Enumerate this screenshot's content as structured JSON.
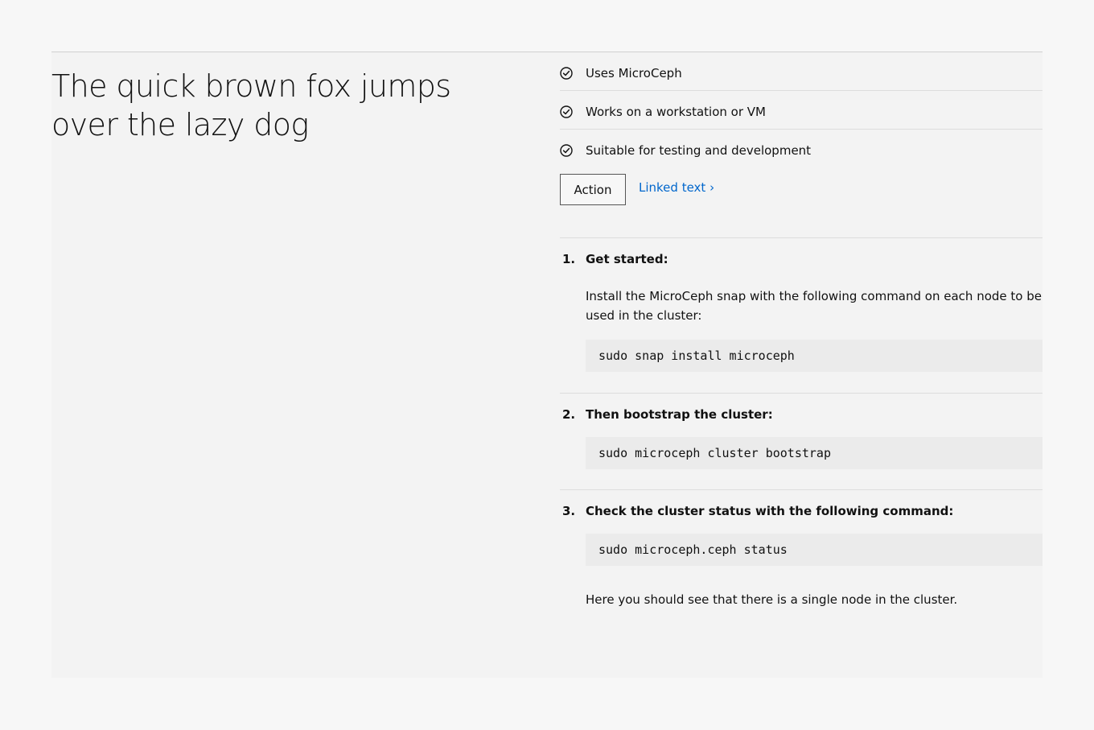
{
  "title": "The quick brown fox jumps over the lazy dog",
  "checks": [
    {
      "label": "Uses MicroCeph",
      "icon": "check-circle-icon"
    },
    {
      "label": "Works on a workstation or VM",
      "icon": "check-circle-icon"
    },
    {
      "label": "Suitable for testing and development",
      "icon": "check-circle-icon"
    }
  ],
  "actions": {
    "button_label": "Action",
    "link_text": "Linked text ›"
  },
  "steps": [
    {
      "number": "1.",
      "title": "Get started:",
      "text": "Install the MicroCeph snap with the following command on each node to be used in the cluster:",
      "code": "sudo snap install microceph"
    },
    {
      "number": "2.",
      "title": "Then bootstrap the cluster:",
      "code": "sudo microceph cluster bootstrap"
    },
    {
      "number": "3.",
      "title": "Check the cluster status with the following command:",
      "code": "sudo microceph.ceph status",
      "text": "Here you should see that there is a single node in the cluster."
    }
  ],
  "colors": {
    "page_background": "#f7f7f7",
    "panel_background": "#f3f3f3",
    "code_background": "#ebebeb",
    "link": "#0066cc",
    "text": "#111111"
  }
}
